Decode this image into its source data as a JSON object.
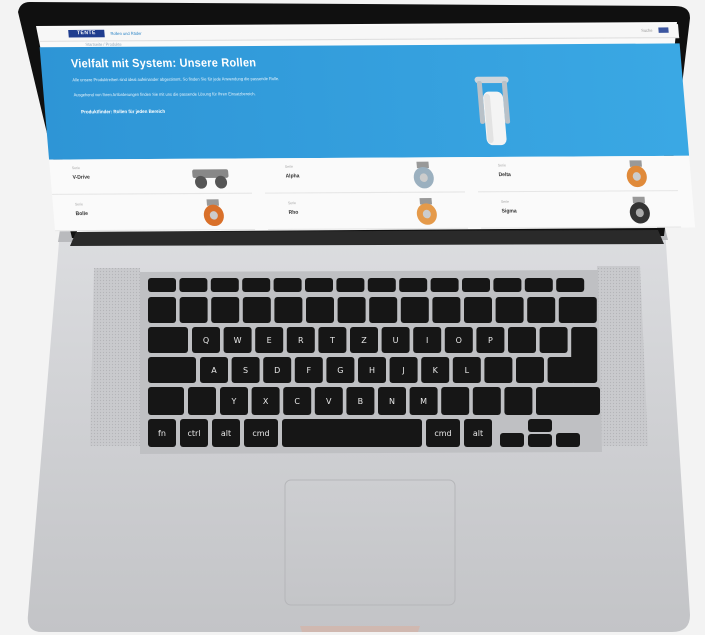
{
  "site": {
    "brand": "TENTE",
    "brand_sub": "Rollen und Räder",
    "lang": "",
    "search_hint": "Suche",
    "breadcrumb": "Startseite / Produkte"
  },
  "hero": {
    "title": "Vielfalt mit System: Unsere Rollen",
    "para1": "Alle unsere Produktreihen sind ideal aufeinander abgestimmt. So finden Sie für jede Anwendung die passende Rolle.",
    "para2": "Ausgehend von Ihren Anforderungen finden Sie mit uns die passende Lösung für Ihren Einsatzbereich.",
    "link": "Produktfinder: Rollen für jeden Bereich"
  },
  "products": [
    {
      "tag": "Serie",
      "name": "V-Drive"
    },
    {
      "tag": "Serie",
      "name": "Alpha"
    },
    {
      "tag": "Serie",
      "name": "Delta"
    },
    {
      "tag": "Serie",
      "name": "Bolle"
    },
    {
      "tag": "Serie",
      "name": "Rho"
    },
    {
      "tag": "Serie",
      "name": "Sigma"
    }
  ],
  "keyboard": {
    "row_letters": [
      "Q",
      "W",
      "E",
      "R",
      "T",
      "Z",
      "U",
      "I",
      "O",
      "P"
    ],
    "row_home": [
      "A",
      "S",
      "D",
      "F",
      "G",
      "H",
      "J",
      "K",
      "L"
    ],
    "row_bottom": [
      "Y",
      "X",
      "C",
      "V",
      "B",
      "N",
      "M"
    ],
    "cmd": "cmd",
    "ctrl": "ctrl",
    "fn": "fn",
    "alt": "alt"
  },
  "colors": {
    "hero_blue": "#3aa8e4",
    "brand_blue": "#1f3d8f",
    "laptop_silver": "#c8c9cb",
    "key_black": "#161616"
  }
}
